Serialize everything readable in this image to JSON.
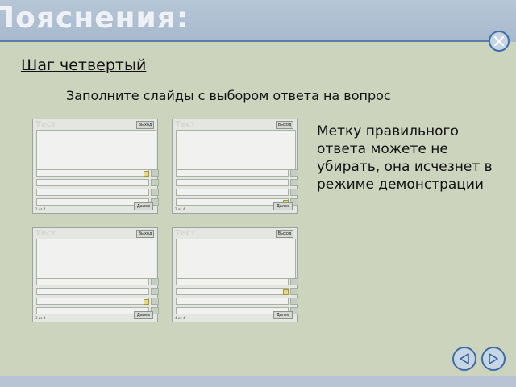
{
  "header": {
    "title": "Пояснения:"
  },
  "step": {
    "title": "Шаг четвертый",
    "subtitle": "Заполните слайды с выбором ответа на вопрос",
    "note": "Метку правильного ответа можете не убирать, она исчезнет в режиме демонстрации"
  },
  "slides": [
    {
      "title": "Тест",
      "exit_label": "Выход",
      "next_label": "Далее",
      "counter": "1 из 4",
      "correct_answer": 1
    },
    {
      "title": "Тест",
      "exit_label": "Выход",
      "next_label": "Далее",
      "counter": "2 из 4",
      "correct_answer": 4
    },
    {
      "title": "Тест",
      "exit_label": "Выход",
      "next_label": "Далее",
      "counter": "3 из 4",
      "correct_answer": 3
    },
    {
      "title": "Тест",
      "exit_label": "Выход",
      "next_label": "Далее",
      "counter": "4 из 4",
      "correct_answer": 2
    }
  ],
  "icons": {
    "close": "close-icon",
    "prev": "triangle-left-icon",
    "next": "triangle-right-icon"
  },
  "colors": {
    "accent": "#3d6ea8",
    "background": "#cdd4bd",
    "header": "#a7b9cd"
  }
}
